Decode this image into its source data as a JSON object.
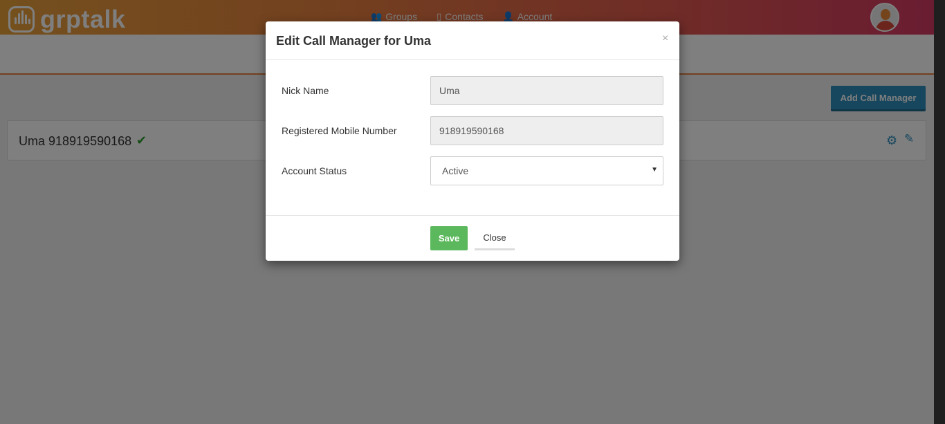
{
  "header": {
    "brand": "grptalk",
    "nav": [
      {
        "label": "Groups",
        "icon": "groups-icon"
      },
      {
        "label": "Contacts",
        "icon": "contacts-icon"
      },
      {
        "label": "Account",
        "icon": "account-icon"
      }
    ],
    "avatar_icon": "user-avatar-icon"
  },
  "page": {
    "add_button_label": "Add Call Manager",
    "manager_row": {
      "name": "Uma 918919590168",
      "verified_icon": "check-icon"
    }
  },
  "modal": {
    "title": "Edit Call Manager for Uma",
    "close_symbol": "×",
    "fields": {
      "nick_name": {
        "label": "Nick Name",
        "value": "Uma"
      },
      "mobile": {
        "label": "Registered Mobile Number",
        "value": "918919590168"
      },
      "status": {
        "label": "Account Status",
        "value": "Active"
      }
    },
    "save_label": "Save",
    "close_label": "Close"
  },
  "colors": {
    "accent_blue": "#2f8fbd",
    "save_green": "#5cb85c",
    "header_gradient": [
      "#e8a13b",
      "#d53a63"
    ]
  }
}
